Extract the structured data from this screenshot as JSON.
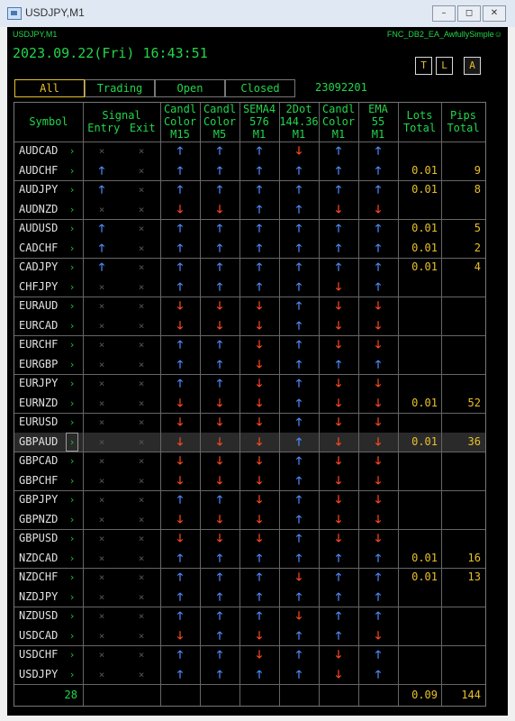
{
  "window": {
    "title": "USDJPY,M1",
    "buttons": [
      "–",
      "◻",
      "✕"
    ]
  },
  "panel": {
    "symbol": "USDJPY,M1",
    "ea_name": "FNC_DB2_EA_AwfullySimple☺",
    "datetime": "2023.09.22(Fri) 16:43:51",
    "modes": [
      "T",
      "L",
      "A"
    ],
    "tabs": [
      "All",
      "Trading",
      "Open",
      "Closed"
    ],
    "date_code": "23092201"
  },
  "headers": {
    "symbol": "Symbol",
    "signal_top": "Signal",
    "entry": "Entry",
    "exit": "Exit",
    "c1": [
      "Candl",
      "Color",
      "M15"
    ],
    "c2": [
      "Candl",
      "Color",
      "M5"
    ],
    "c3": [
      "SEMA4",
      "576",
      "M1"
    ],
    "c4": [
      "2Dot",
      "144.36",
      "M1"
    ],
    "c5": [
      "Candl",
      "Color",
      "M1"
    ],
    "c6": [
      "EMA",
      "55",
      "M1"
    ],
    "lots": [
      "Lots",
      "Total"
    ],
    "pips": [
      "Pips",
      "Total"
    ]
  },
  "rows": [
    {
      "symbol": "AUDCAD",
      "cols": [
        "x",
        "x",
        "up",
        "up",
        "up",
        "dn",
        "up",
        "up"
      ],
      "lots": "",
      "pips": ""
    },
    {
      "symbol": "AUDCHF",
      "cols": [
        "up",
        "x",
        "up",
        "up",
        "up",
        "up",
        "up",
        "up"
      ],
      "lots": "0.01",
      "pips": "9"
    },
    {
      "symbol": "AUDJPY",
      "cols": [
        "up",
        "x",
        "up",
        "up",
        "up",
        "up",
        "up",
        "up"
      ],
      "lots": "0.01",
      "pips": "8"
    },
    {
      "symbol": "AUDNZD",
      "cols": [
        "x",
        "x",
        "dn",
        "dn",
        "up",
        "up",
        "dn",
        "dn"
      ],
      "lots": "",
      "pips": ""
    },
    {
      "symbol": "AUDUSD",
      "cols": [
        "up",
        "x",
        "up",
        "up",
        "up",
        "up",
        "up",
        "up"
      ],
      "lots": "0.01",
      "pips": "5"
    },
    {
      "symbol": "CADCHF",
      "cols": [
        "up",
        "x",
        "up",
        "up",
        "up",
        "up",
        "up",
        "up"
      ],
      "lots": "0.01",
      "pips": "2"
    },
    {
      "symbol": "CADJPY",
      "cols": [
        "up",
        "x",
        "up",
        "up",
        "up",
        "up",
        "up",
        "up"
      ],
      "lots": "0.01",
      "pips": "4"
    },
    {
      "symbol": "CHFJPY",
      "cols": [
        "x",
        "x",
        "up",
        "up",
        "up",
        "up",
        "dn",
        "up"
      ],
      "lots": "",
      "pips": ""
    },
    {
      "symbol": "EURAUD",
      "cols": [
        "x",
        "x",
        "dn",
        "dn",
        "dn",
        "up",
        "dn",
        "dn"
      ],
      "lots": "",
      "pips": ""
    },
    {
      "symbol": "EURCAD",
      "cols": [
        "x",
        "x",
        "dn",
        "dn",
        "dn",
        "up",
        "dn",
        "dn"
      ],
      "lots": "",
      "pips": ""
    },
    {
      "symbol": "EURCHF",
      "cols": [
        "x",
        "x",
        "up",
        "up",
        "dn",
        "up",
        "dn",
        "dn"
      ],
      "lots": "",
      "pips": ""
    },
    {
      "symbol": "EURGBP",
      "cols": [
        "x",
        "x",
        "up",
        "up",
        "dn",
        "up",
        "up",
        "up"
      ],
      "lots": "",
      "pips": ""
    },
    {
      "symbol": "EURJPY",
      "cols": [
        "x",
        "x",
        "up",
        "up",
        "dn",
        "up",
        "dn",
        "dn"
      ],
      "lots": "",
      "pips": ""
    },
    {
      "symbol": "EURNZD",
      "cols": [
        "x",
        "x",
        "dn",
        "dn",
        "dn",
        "up",
        "dn",
        "dn"
      ],
      "lots": "0.01",
      "pips": "52"
    },
    {
      "symbol": "EURUSD",
      "cols": [
        "x",
        "x",
        "dn",
        "dn",
        "dn",
        "up",
        "dn",
        "dn"
      ],
      "lots": "",
      "pips": ""
    },
    {
      "symbol": "GBPAUD",
      "cols": [
        "x",
        "x",
        "dn",
        "dn",
        "dn",
        "up",
        "dn",
        "dn"
      ],
      "lots": "0.01",
      "pips": "36",
      "highlight": true
    },
    {
      "symbol": "GBPCAD",
      "cols": [
        "x",
        "x",
        "dn",
        "dn",
        "dn",
        "up",
        "dn",
        "dn"
      ],
      "lots": "",
      "pips": ""
    },
    {
      "symbol": "GBPCHF",
      "cols": [
        "x",
        "x",
        "dn",
        "dn",
        "dn",
        "up",
        "dn",
        "dn"
      ],
      "lots": "",
      "pips": ""
    },
    {
      "symbol": "GBPJPY",
      "cols": [
        "x",
        "x",
        "up",
        "up",
        "dn",
        "up",
        "dn",
        "dn"
      ],
      "lots": "",
      "pips": ""
    },
    {
      "symbol": "GBPNZD",
      "cols": [
        "x",
        "x",
        "dn",
        "dn",
        "dn",
        "up",
        "dn",
        "dn"
      ],
      "lots": "",
      "pips": ""
    },
    {
      "symbol": "GBPUSD",
      "cols": [
        "x",
        "x",
        "dn",
        "dn",
        "dn",
        "up",
        "dn",
        "dn"
      ],
      "lots": "",
      "pips": ""
    },
    {
      "symbol": "NZDCAD",
      "cols": [
        "x",
        "x",
        "up",
        "up",
        "up",
        "up",
        "up",
        "up"
      ],
      "lots": "0.01",
      "pips": "16"
    },
    {
      "symbol": "NZDCHF",
      "cols": [
        "x",
        "x",
        "up",
        "up",
        "up",
        "dn",
        "up",
        "up"
      ],
      "lots": "0.01",
      "pips": "13"
    },
    {
      "symbol": "NZDJPY",
      "cols": [
        "x",
        "x",
        "up",
        "up",
        "up",
        "up",
        "up",
        "up"
      ],
      "lots": "",
      "pips": ""
    },
    {
      "symbol": "NZDUSD",
      "cols": [
        "x",
        "x",
        "up",
        "up",
        "up",
        "dn",
        "up",
        "up"
      ],
      "lots": "",
      "pips": ""
    },
    {
      "symbol": "USDCAD",
      "cols": [
        "x",
        "x",
        "dn",
        "up",
        "dn",
        "up",
        "up",
        "dn"
      ],
      "lots": "",
      "pips": ""
    },
    {
      "symbol": "USDCHF",
      "cols": [
        "x",
        "x",
        "up",
        "up",
        "dn",
        "up",
        "dn",
        "up"
      ],
      "lots": "",
      "pips": ""
    },
    {
      "symbol": "USDJPY",
      "cols": [
        "x",
        "x",
        "up",
        "up",
        "up",
        "up",
        "dn",
        "up"
      ],
      "lots": "",
      "pips": ""
    }
  ],
  "footer": {
    "count": "28",
    "lots_total": "0.09",
    "pips_total": "144"
  },
  "colors": {
    "green": "#22d64a",
    "yellow": "#e8c02a",
    "up_arrow": "#4f8bff",
    "down_arrow": "#ff4a22",
    "background": "#000000"
  },
  "glyphs": {
    "up": "🡑",
    "dn": "🡓",
    "x": "×",
    "chevron": "›"
  }
}
